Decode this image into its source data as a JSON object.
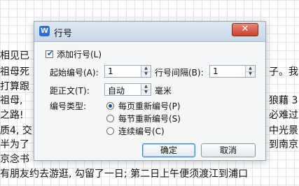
{
  "background_lines": [
    "相见已",
    "祖母死",
    "打算跟",
    "祖母,",
    "之路!",
    "质4, 交",
    "半为了",
    "京念书",
    "有朋友约去游逛, 勾留了一日; 第二日上午便须渡江到浦口",
    "子。我",
    "狼藉 3",
    "必难过",
    "中光景",
    "到南京"
  ],
  "dialog": {
    "title": "行号",
    "close_symbol": "✕",
    "add_line_numbers": {
      "label": "添加行号(L)",
      "checked": true
    },
    "start_number": {
      "label": "起始编号(A):",
      "value": "1"
    },
    "line_interval": {
      "label": "行号间隔(B):",
      "value": "1"
    },
    "distance": {
      "label": "距正文(T):",
      "value": "自动",
      "unit": "毫米"
    },
    "numbering_type": {
      "label": "编号类型:",
      "options": [
        {
          "label": "每页重新编号(P)",
          "selected": true
        },
        {
          "label": "每节重新编号(S)",
          "selected": false
        },
        {
          "label": "连续编号(C)",
          "selected": false
        }
      ]
    },
    "ok_label": "确定",
    "cancel_label": "取消"
  },
  "colors": {
    "accent": "#2a6fd6",
    "close": "#c8402c"
  },
  "icons": {
    "app": "wps-writer-icon",
    "close": "close-icon"
  }
}
